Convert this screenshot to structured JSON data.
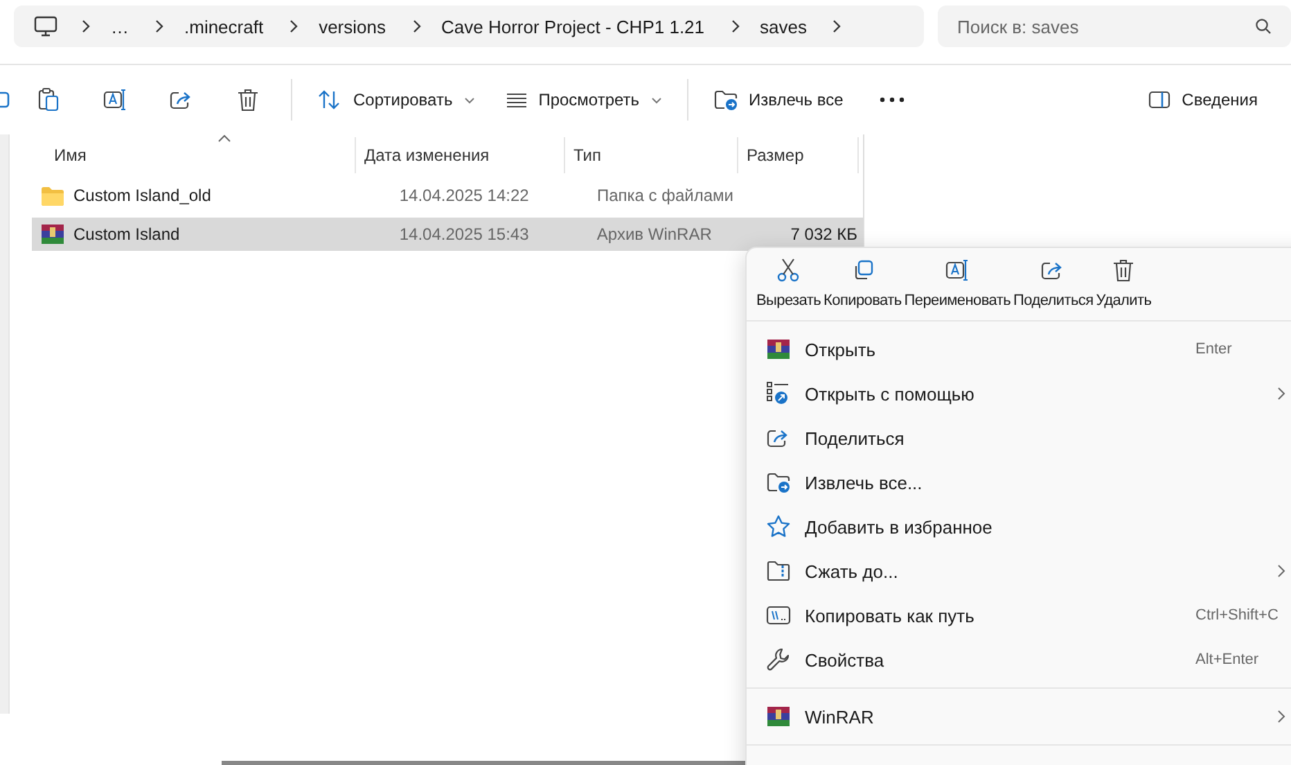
{
  "address_bar": {
    "crumbs": [
      "…",
      ".minecraft",
      "versions",
      "Cave Horror Project - CHP1 1.21",
      "saves"
    ]
  },
  "search": {
    "placeholder": "Поиск в: saves"
  },
  "toolbar": {
    "actions": [
      {
        "label": "Сортировать",
        "dropdown": true
      },
      {
        "label": "Просмотреть",
        "dropdown": true
      },
      {
        "label": "Извлечь все",
        "dropdown": false
      }
    ],
    "details": "Сведения"
  },
  "table": {
    "columns": [
      "Имя",
      "Дата изменения",
      "Тип",
      "Размер"
    ],
    "rows": [
      {
        "kind": "folder",
        "name": "Custom Island_old",
        "date": "14.04.2025 14:22",
        "type": "Папка с файлами",
        "selected": false
      },
      {
        "kind": "archive",
        "name": "Custom Island",
        "date": "14.04.2025 15:43",
        "type": "Архив WinRAR",
        "size": "7 032 КБ",
        "selected": true
      }
    ]
  },
  "context_menu": {
    "quick_actions": [
      "Вырезать",
      "Копировать",
      "Переименовать",
      "Поделиться",
      "Удалить"
    ],
    "sections": [
      [
        {
          "label": "Открыть",
          "shortcut": "Enter",
          "submenu": false
        },
        {
          "label": "Открыть с помощью",
          "submenu": true
        },
        {
          "label": "Поделиться",
          "submenu": false
        },
        {
          "label": "Извлечь все...",
          "submenu": false
        },
        {
          "label": "Добавить в избранное",
          "submenu": false
        },
        {
          "label": "Сжать до...",
          "submenu": true
        },
        {
          "label": "Копировать как путь",
          "shortcut": "Ctrl+Shift+C",
          "submenu": false
        },
        {
          "label": "Свойства",
          "shortcut": "Alt+Enter",
          "submenu": false
        }
      ],
      [
        {
          "label": "WinRAR",
          "submenu": true
        }
      ]
    ]
  }
}
